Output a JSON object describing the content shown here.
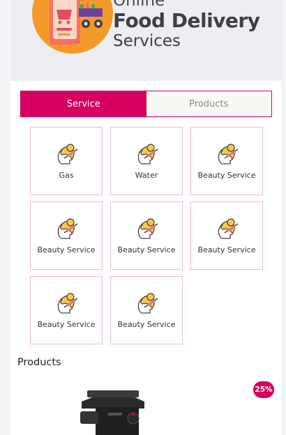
{
  "banner": {
    "logo_line0": "Online",
    "logo_line1": "Food Delivery",
    "logo_line2": "Services"
  },
  "tabs": [
    {
      "label": "Service",
      "active": true
    },
    {
      "label": "Products",
      "active": false
    }
  ],
  "services": [
    {
      "label": "Gas",
      "icon": "beauty-head-icon"
    },
    {
      "label": "Water",
      "icon": "beauty-head-icon"
    },
    {
      "label": "Beauty Service",
      "icon": "beauty-head-icon"
    },
    {
      "label": "Beauty Service",
      "icon": "beauty-head-icon"
    },
    {
      "label": "Beauty Service",
      "icon": "beauty-head-icon"
    },
    {
      "label": "Beauty Service",
      "icon": "beauty-head-icon"
    },
    {
      "label": "Beauty Service",
      "icon": "beauty-head-icon"
    },
    {
      "label": "Beauty Service",
      "icon": "beauty-head-icon"
    }
  ],
  "products": {
    "title": "Products",
    "items": [
      {
        "discount_badge": "25%"
      }
    ]
  },
  "colors": {
    "accent": "#d6005f",
    "card_border": "#f2b8cf",
    "banner_bg": "#eceef1"
  }
}
